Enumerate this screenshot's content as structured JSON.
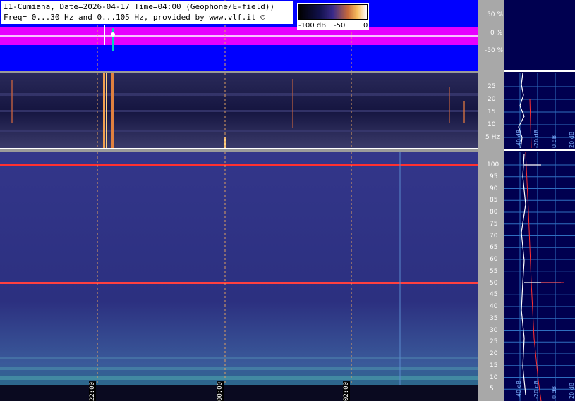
{
  "header": {
    "line1": "I1-Cumiana, Date=2026-04-17 Time=04:00 (Geophone/E-field))",
    "line2": "Freq= 0...30 Hz and 0...105 Hz, provided by www.vlf.it ©"
  },
  "colorbar": {
    "labels": [
      "-100 dB",
      "-50",
      "0"
    ]
  },
  "amplitude_scale": {
    "labels": [
      "50 %",
      "0 %",
      "-50 %"
    ]
  },
  "low_freq_scale": {
    "labels": [
      "25",
      "20",
      "15",
      "10",
      "5 Hz"
    ]
  },
  "high_freq_scale": {
    "labels": [
      "100",
      "95",
      "90",
      "85",
      "80",
      "75",
      "70",
      "65",
      "60",
      "55",
      "50",
      "45",
      "40",
      "35",
      "30",
      "25",
      "20",
      "15",
      "10",
      "5"
    ]
  },
  "time_axis": {
    "labels": [
      "22:00",
      "00:00",
      "02:00"
    ]
  },
  "side_panel_low": {
    "labels": [
      "-40 dB",
      "-20 dB",
      "0 dB",
      "20 dB"
    ]
  },
  "side_panel_high": {
    "labels": [
      "-40 dB",
      "-20 dB",
      "0 dB",
      "20 dB"
    ]
  },
  "colors": {
    "waveform_bg": "#0000ff",
    "waveform_trace": "#ff00ff",
    "spectrogram_bg": "#2c2f7a",
    "marker": "#ff3030"
  }
}
